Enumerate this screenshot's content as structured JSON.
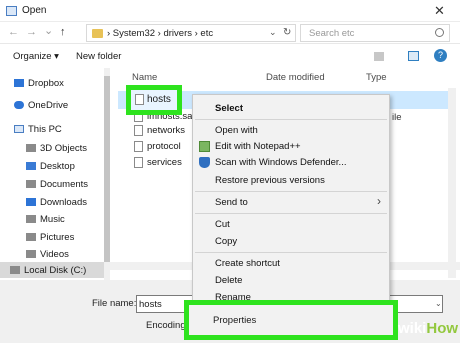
{
  "window": {
    "title": "Open",
    "close_glyph": "✕"
  },
  "address": {
    "back_glyph": "←",
    "forward_glyph": "→",
    "recent_glyph": "⌄",
    "up_glyph": "↑",
    "crumbs": "›  System32  ›  drivers  ›  etc",
    "dropdown_glyph": "⌄",
    "refresh_glyph": "↻",
    "search_placeholder": "Search etc"
  },
  "toolbar": {
    "organize": "Organize ▾",
    "new_folder": "New folder",
    "help": "?"
  },
  "nav": {
    "items": [
      {
        "label": "Dropbox",
        "icon": "dropbox-icon",
        "color": "#2d74d6"
      },
      {
        "label": "OneDrive",
        "icon": "onedrive-icon",
        "color": "#2d74d6"
      },
      {
        "label": "This PC",
        "icon": "computer-icon",
        "color": "#4a7ec2"
      },
      {
        "label": "3D Objects",
        "icon": "3d-objects-icon",
        "color": "#8a8a8a"
      },
      {
        "label": "Desktop",
        "icon": "desktop-icon",
        "color": "#3a7bd5"
      },
      {
        "label": "Documents",
        "icon": "documents-icon",
        "color": "#8a8a8a"
      },
      {
        "label": "Downloads",
        "icon": "downloads-icon",
        "color": "#2d74d6"
      },
      {
        "label": "Music",
        "icon": "music-icon",
        "color": "#8a8a8a"
      },
      {
        "label": "Pictures",
        "icon": "pictures-icon",
        "color": "#8a8a8a"
      },
      {
        "label": "Videos",
        "icon": "videos-icon",
        "color": "#8a8a8a"
      }
    ],
    "local_disk": "Local Disk (C:)"
  },
  "files": {
    "columns": {
      "name": "Name",
      "date": "Date modified",
      "type": "Type"
    },
    "rows": [
      {
        "name": "hosts"
      },
      {
        "name": "lmhosts.sam"
      },
      {
        "name": "networks"
      },
      {
        "name": "protocol"
      },
      {
        "name": "services"
      }
    ],
    "type_fragment": "ile"
  },
  "context_menu": {
    "select": "Select",
    "open_with": "Open with",
    "edit_notepad": "Edit with Notepad++",
    "scan_defender": "Scan with Windows Defender...",
    "restore": "Restore previous versions",
    "send_to": "Send to",
    "send_to_arrow": "›",
    "cut": "Cut",
    "copy": "Copy",
    "create_shortcut": "Create shortcut",
    "delete": "Delete",
    "rename": "Rename",
    "properties": "Properties"
  },
  "bottom": {
    "file_name_label": "File name:",
    "file_name_value": "hosts",
    "encoding_label": "Encoding",
    "dropdown_glyph": "⌄"
  },
  "colors": {
    "highlight": "#2ee31e",
    "selection": "#cce8ff",
    "accent": "#2f7fc1"
  },
  "watermark": {
    "part1": "wiki",
    "part2": "How"
  }
}
